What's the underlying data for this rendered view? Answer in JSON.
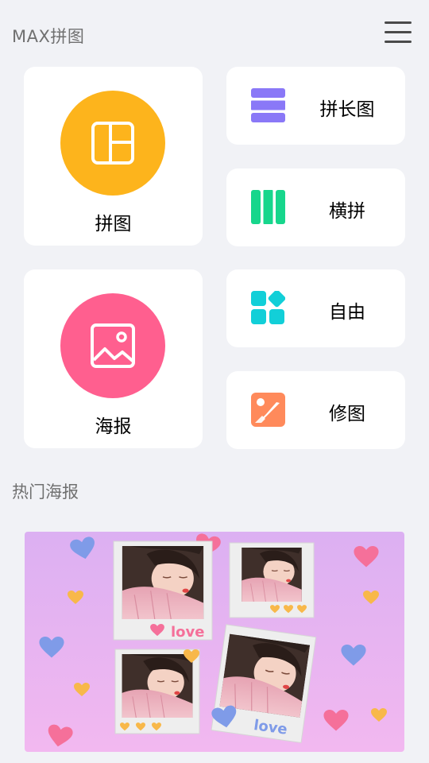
{
  "header": {
    "title": "MAX拼图",
    "menu_icon": "hamburger-menu-icon"
  },
  "features": {
    "collage": {
      "label": "拼图",
      "icon": "collage-layout-icon",
      "color": "#fdb41c"
    },
    "poster": {
      "label": "海报",
      "icon": "image-frame-icon",
      "color": "#ff5f8f"
    },
    "long_stitch": {
      "label": "拼长图",
      "icon": "horizontal-bars-icon",
      "color": "#8a78f7"
    },
    "side_stitch": {
      "label": "横拼",
      "icon": "vertical-bars-icon",
      "color": "#17d68c"
    },
    "freestyle": {
      "label": "自由",
      "icon": "shapes-grid-icon",
      "color": "#12cfd8"
    },
    "retouch": {
      "label": "修图",
      "icon": "photo-edit-icon",
      "color": "#ff8a5b"
    }
  },
  "popular_posters": {
    "title": "热门海报",
    "items": [
      {
        "caption_1": "love",
        "caption_2": "love"
      }
    ]
  },
  "colors": {
    "background": "#f1f2f6",
    "card": "#ffffff",
    "poster_top": "#dcb0f2",
    "poster_bottom": "#f2b8f0",
    "heart_blue": "#7f9be8",
    "heart_pink": "#f5709a",
    "heart_yellow": "#f8b84a"
  }
}
